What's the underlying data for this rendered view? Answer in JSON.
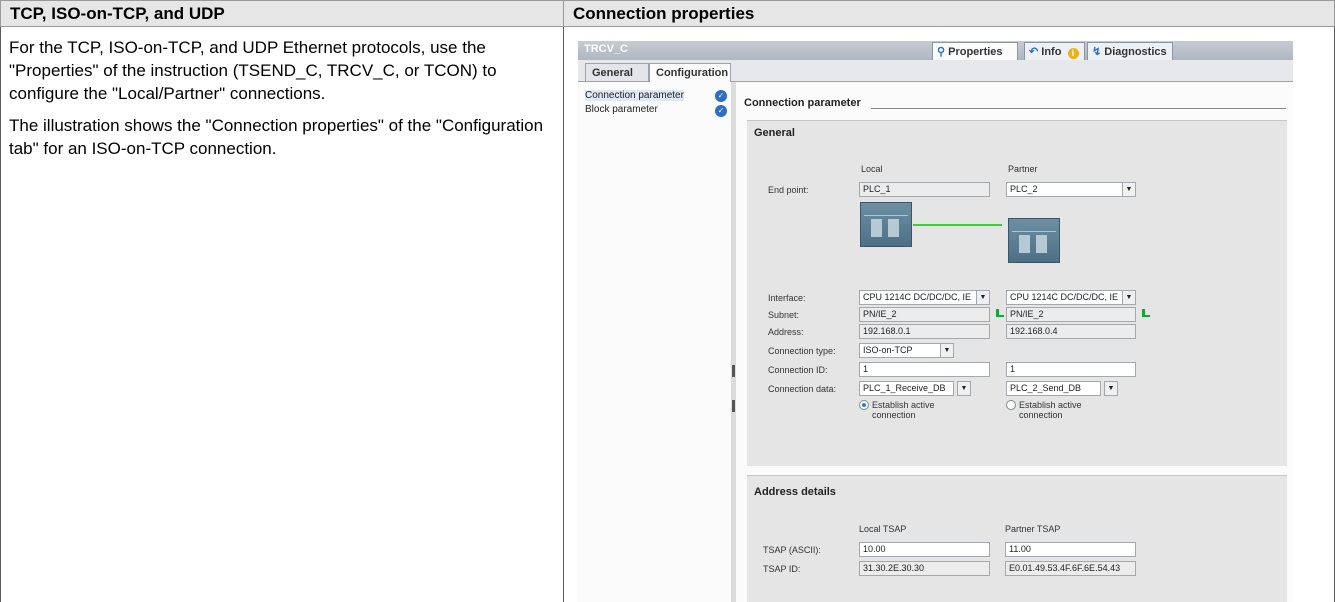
{
  "header": {
    "left_title": "TCP, ISO-on-TCP, and UDP",
    "right_title": "Connection properties"
  },
  "body": {
    "paragraph1": "For the TCP, ISO-on-TCP, and UDP Ethernet protocols, use the \"Properties\" of the instruction (TSEND_C, TRCV_C, or TCON) to configure the \"Local/Partner\" connections.",
    "paragraph2": "The illustration shows the \"Connection properties\" of the \"Configuration tab\" for an ISO-on-TCP connection."
  },
  "screenshot": {
    "title": "TRCV_C",
    "top_tabs": {
      "properties": "Properties",
      "info": "Info",
      "diagnostics": "Diagnostics"
    },
    "tabs": {
      "general": "General",
      "configuration": "Configuration"
    },
    "nav": {
      "connection_parameter": "Connection parameter",
      "block_parameter": "Block parameter"
    },
    "section_title": "Connection parameter",
    "general": {
      "header": "General",
      "col_local": "Local",
      "col_partner": "Partner",
      "end_point_label": "End point:",
      "end_point_local": "PLC_1",
      "end_point_partner": "PLC_2",
      "interface_label": "Interface:",
      "interface_local": "CPU 1214C DC/DC/DC, IE",
      "interface_partner": "CPU 1214C DC/DC/DC, IE",
      "subnet_label": "Subnet:",
      "subnet_local": "PN/IE_2",
      "subnet_partner": "PN/IE_2",
      "address_label": "Address:",
      "address_local": "192.168.0.1",
      "address_partner": "192.168.0.4",
      "conn_type_label": "Connection type:",
      "conn_type_value": "ISO-on-TCP",
      "conn_id_label": "Connection ID:",
      "conn_id_local": "1",
      "conn_id_partner": "1",
      "conn_data_label": "Connection data:",
      "conn_data_local": "PLC_1_Receive_DB",
      "conn_data_partner": "PLC_2_Send_DB",
      "establish_local": "Establish active connection",
      "establish_partner": "Establish active connection"
    },
    "address_details": {
      "header": "Address details",
      "col_local": "Local TSAP",
      "col_partner": "Partner TSAP",
      "tsap_ascii_label": "TSAP (ASCII):",
      "tsap_ascii_local": "10.00",
      "tsap_ascii_partner": "11.00",
      "tsap_id_label": "TSAP ID:",
      "tsap_id_local": "31.30.2E.30.30",
      "tsap_id_partner": "E0.01.49.53.4F.6F.6E.54.43"
    }
  }
}
